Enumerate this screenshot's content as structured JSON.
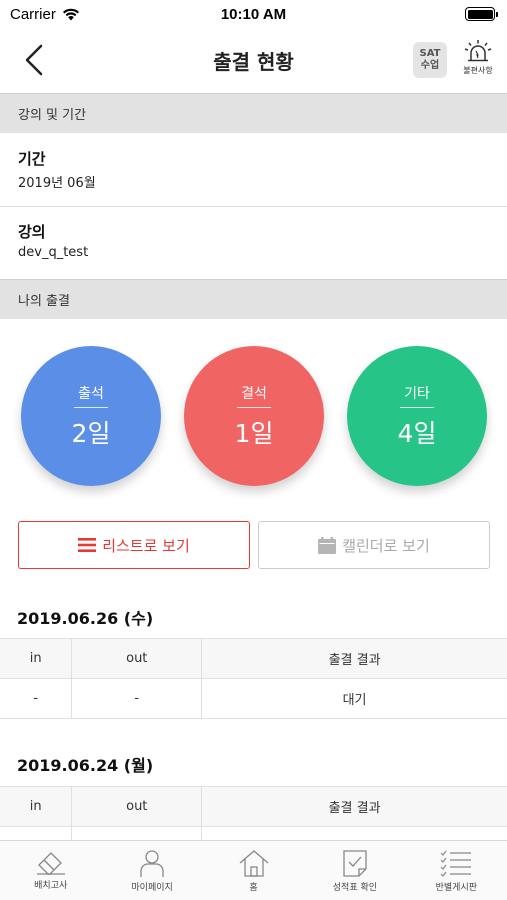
{
  "status_bar": {
    "carrier": "Carrier",
    "time": "10:10 AM"
  },
  "nav": {
    "title": "출결 현황",
    "sat_line1": "SAT",
    "sat_line2": "수업",
    "notice_label": "불편사항"
  },
  "sections": {
    "lecture_period": "강의 및 기간",
    "my_attendance": "나의 출결"
  },
  "period": {
    "label": "기간",
    "value": "2019년 06월"
  },
  "lecture": {
    "label": "강의",
    "value": "dev_q_test"
  },
  "stats": [
    {
      "label": "출석",
      "value": "2일",
      "color": "#5b8ee6"
    },
    {
      "label": "결석",
      "value": "1일",
      "color": "#f06464"
    },
    {
      "label": "기타",
      "value": "4일",
      "color": "#27c487"
    }
  ],
  "view_toggle": {
    "list_label": "리스트로 보기",
    "calendar_label": "캘린더로 보기",
    "active": "list"
  },
  "table_headers": [
    "in",
    "out",
    "출결 결과"
  ],
  "records": [
    {
      "date": "2019.06.26 (수)",
      "row": [
        "-",
        "-",
        "대기"
      ]
    },
    {
      "date": "2019.06.24 (월)",
      "row": []
    }
  ],
  "tabs": [
    {
      "label": "배치고사",
      "icon": "pencil-eraser-icon"
    },
    {
      "label": "마이페이지",
      "icon": "person-icon"
    },
    {
      "label": "홈",
      "icon": "home-icon"
    },
    {
      "label": "성적표 확인",
      "icon": "report-check-icon"
    },
    {
      "label": "반별게시판",
      "icon": "checklist-icon"
    }
  ]
}
